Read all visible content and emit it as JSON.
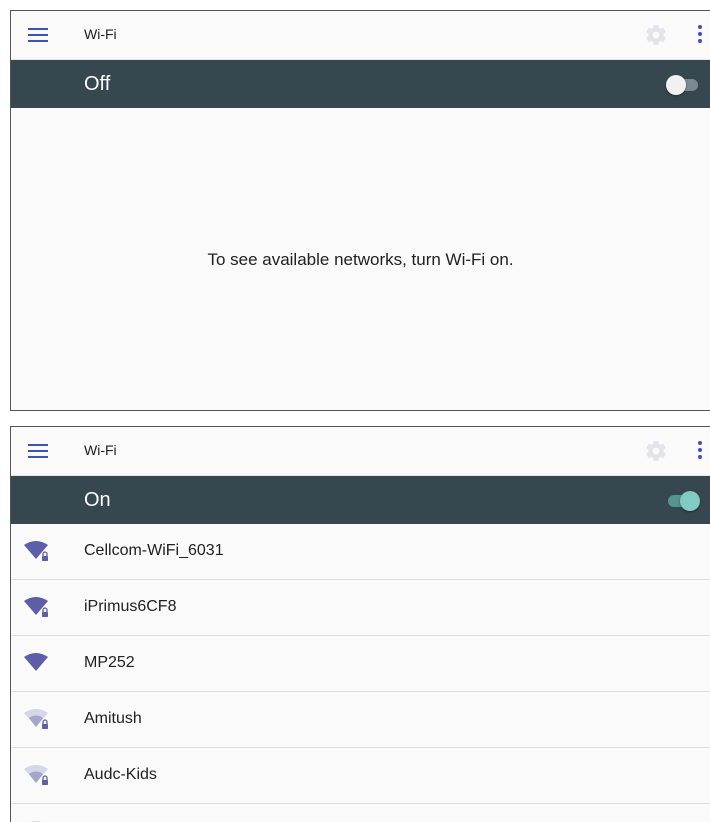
{
  "colors": {
    "accent": "#3f51b5",
    "master_bar": "#37474f",
    "switch_on": "#80cbc4",
    "switch_off": "#f1f1f1",
    "signal_strong": "#5c5fa8",
    "signal_weak": "#a3a5cb"
  },
  "panel_off": {
    "toolbar": {
      "title": "Wi-Fi",
      "menu_icon": "hamburger-icon",
      "settings_icon": "gear-icon",
      "overflow_icon": "more-vert-icon"
    },
    "master": {
      "label": "Off",
      "switch_on": false
    },
    "empty_message": "To see available networks, turn Wi-Fi on."
  },
  "panel_on": {
    "toolbar": {
      "title": "Wi-Fi",
      "menu_icon": "hamburger-icon",
      "settings_icon": "gear-icon",
      "overflow_icon": "more-vert-icon"
    },
    "master": {
      "label": "On",
      "switch_on": true
    },
    "networks": [
      {
        "name": "Cellcom-WiFi_6031",
        "signal": "strong",
        "secured": true
      },
      {
        "name": "iPrimus6CF8",
        "signal": "strong",
        "secured": true
      },
      {
        "name": "MP252",
        "signal": "strong",
        "secured": false
      },
      {
        "name": "Amitush",
        "signal": "weak",
        "secured": true
      },
      {
        "name": "Audc-Kids",
        "signal": "weak",
        "secured": true
      },
      {
        "name": "",
        "signal": "weak",
        "secured": false
      }
    ]
  }
}
